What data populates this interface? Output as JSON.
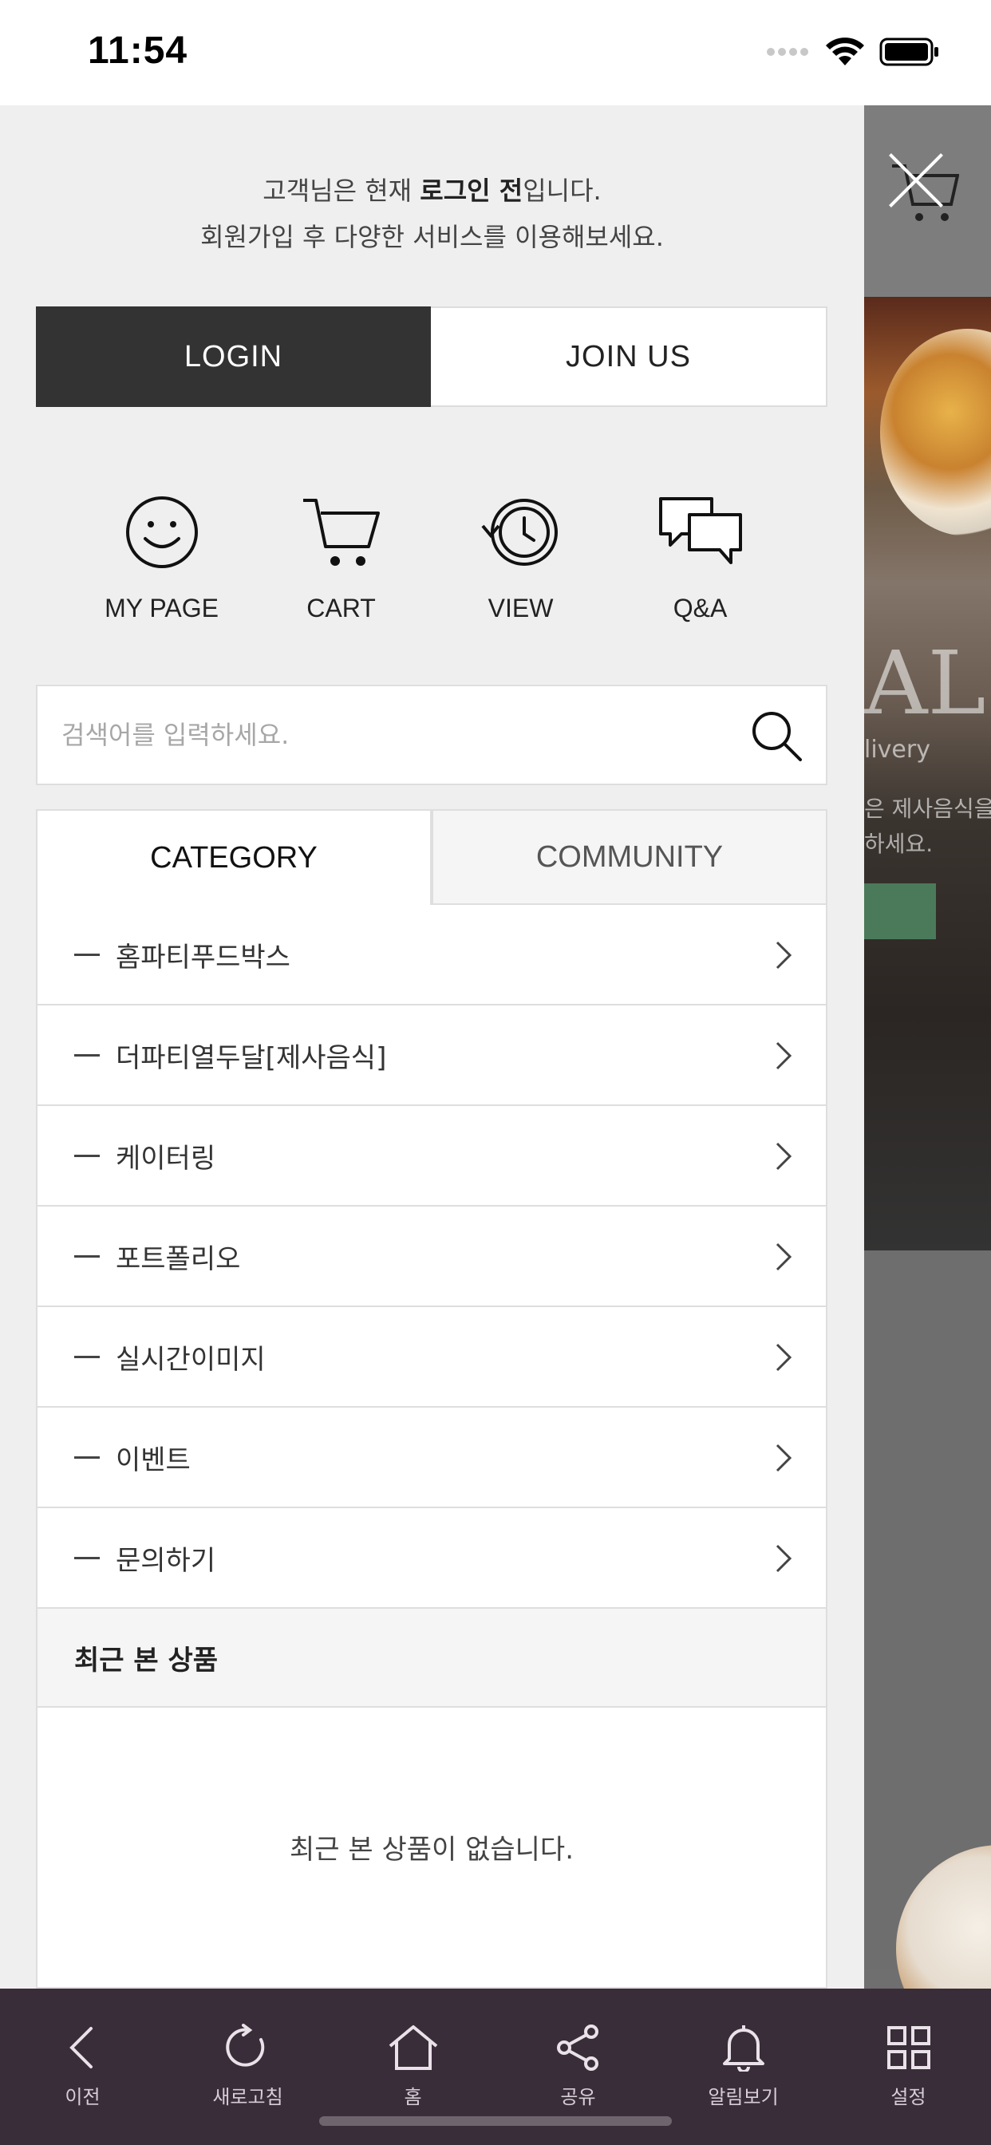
{
  "status_bar": {
    "time": "11:54"
  },
  "drawer": {
    "notice": {
      "prefix": "고객님은 현재 ",
      "bold": "로그인 전",
      "suffix": "입니다.",
      "line2": "회원가입 후 다양한 서비스를 이용해보세요."
    },
    "auth": {
      "login_label": "LOGIN",
      "join_label": "JOIN US"
    },
    "quick_links": [
      {
        "label": "MY PAGE",
        "icon": "smiley-icon"
      },
      {
        "label": "CART",
        "icon": "cart-icon"
      },
      {
        "label": "VIEW",
        "icon": "history-clock-icon"
      },
      {
        "label": "Q&A",
        "icon": "chat-bubbles-icon"
      }
    ],
    "search": {
      "placeholder": "검색어를 입력하세요."
    },
    "tabs": {
      "category": "CATEGORY",
      "community": "COMMUNITY",
      "active": "category"
    },
    "categories": [
      "홈파티푸드박스",
      "더파티열두달[제사음식]",
      "케이터링",
      "포트폴리오",
      "실시간이미지",
      "이벤트",
      "문의하기"
    ],
    "recent": {
      "title": "최근 본 상품",
      "empty_text": "최근 본 상품이 없습니다."
    }
  },
  "background_page": {
    "big_text": "AL",
    "sub_text": "livery",
    "ko_text_1": "은 제사음식을",
    "ko_text_2": "하세요."
  },
  "toolbar": {
    "items": [
      {
        "label": "이전",
        "icon": "back-chevron-icon"
      },
      {
        "label": "새로고침",
        "icon": "refresh-icon"
      },
      {
        "label": "홈",
        "icon": "home-icon"
      },
      {
        "label": "공유",
        "icon": "share-icon"
      },
      {
        "label": "알림보기",
        "icon": "bell-icon"
      },
      {
        "label": "설정",
        "icon": "grid-icon"
      }
    ]
  },
  "colors": {
    "drawer_bg": "#efefef",
    "login_button_bg": "#333333",
    "toolbar_bg": "#3a2d3a"
  }
}
